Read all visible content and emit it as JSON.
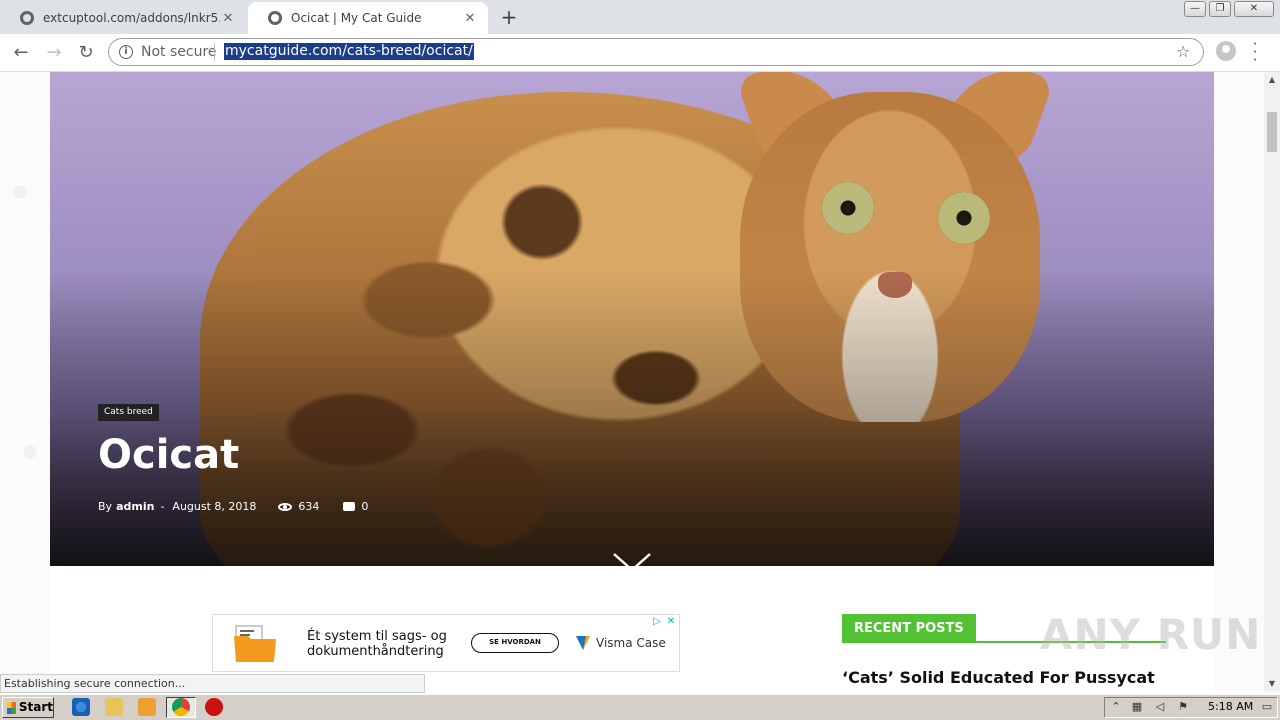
{
  "browser": {
    "tabs": [
      {
        "title": "extcuptool.com/addons/lnkr5.min.js",
        "active": false
      },
      {
        "title": "Ocicat | My Cat Guide",
        "active": true
      }
    ],
    "address": {
      "security_label": "Not secure",
      "url": "mycatguide.com/cats-breed/ocicat/"
    },
    "status_text": "Establishing secure connection..."
  },
  "article": {
    "category": "Cats breed",
    "title": "Ocicat",
    "by_label": "By",
    "author": "admin",
    "separator": "-",
    "date": "August 8, 2018",
    "views": "634",
    "comments": "0"
  },
  "ad": {
    "text": "Ét system til sags- og dokumenthåndtering",
    "cta": "SE HVORDAN",
    "brand": "Visma Case"
  },
  "sidebar": {
    "recent_posts_label": "RECENT POSTS",
    "first_post_title": "‘Cats’ Solid Educated For Pussycat"
  },
  "watermark": "ANY RUN",
  "taskbar": {
    "start_label": "Start",
    "clock": "5:18 AM"
  },
  "colors": {
    "accent_green": "#52c234",
    "url_selection": "#1a3e8a"
  }
}
